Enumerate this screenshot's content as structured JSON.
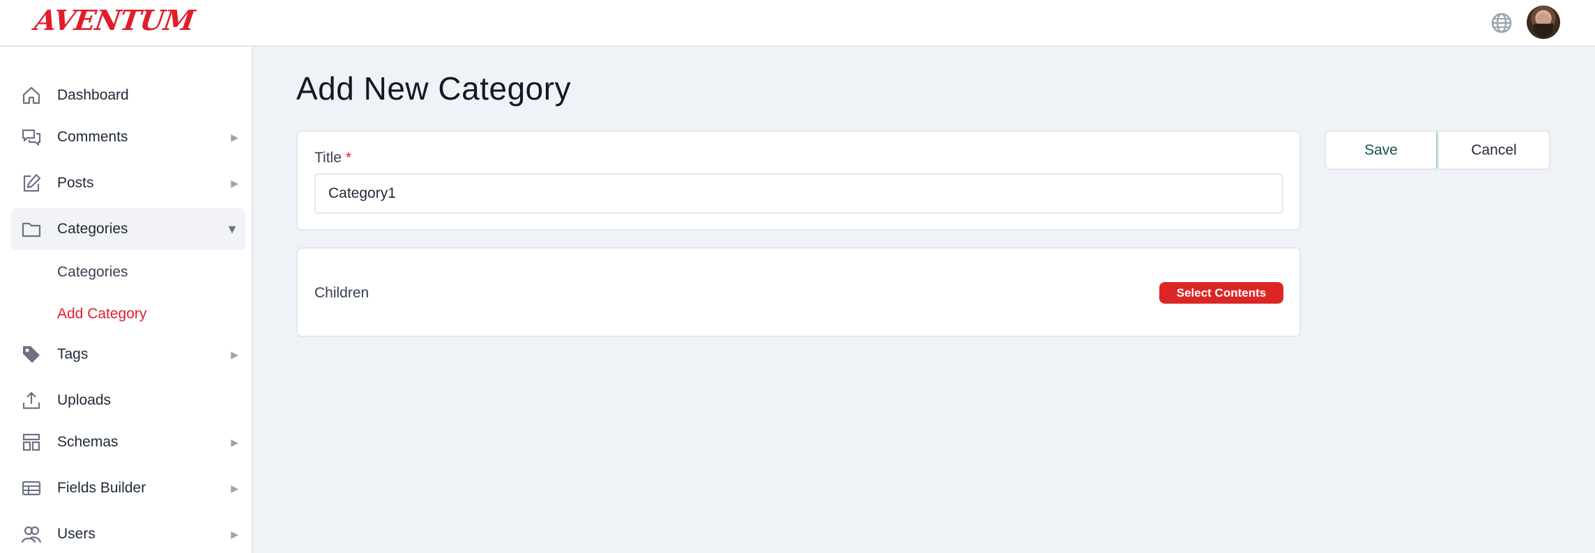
{
  "header": {
    "logo_text": "AVENTUM",
    "globe_icon": "globe-icon",
    "avatar_icon": "avatar"
  },
  "sidebar": {
    "items": [
      {
        "label": "Dashboard",
        "icon": "home-icon",
        "arrow": ""
      },
      {
        "label": "Comments",
        "icon": "comments-icon",
        "arrow": "▶"
      },
      {
        "label": "Posts",
        "icon": "edit-icon",
        "arrow": "▶"
      },
      {
        "label": "Categories",
        "icon": "folder-icon",
        "arrow": "▼"
      },
      {
        "label": "Tags",
        "icon": "tag-icon",
        "arrow": "▶"
      },
      {
        "label": "Uploads",
        "icon": "upload-icon",
        "arrow": ""
      },
      {
        "label": "Schemas",
        "icon": "layout-icon",
        "arrow": "▶"
      },
      {
        "label": "Fields Builder",
        "icon": "table-icon",
        "arrow": "▶"
      },
      {
        "label": "Users",
        "icon": "users-icon",
        "arrow": "▶"
      }
    ],
    "sub_items": [
      {
        "label": "Categories"
      },
      {
        "label": "Add Category"
      }
    ]
  },
  "main": {
    "page_title": "Add New Category",
    "title_field": {
      "label": "Title",
      "required_mark": "*",
      "value": "Category1"
    },
    "children": {
      "label": "Children",
      "button_label": "Select Contents"
    },
    "actions": {
      "save_label": "Save",
      "cancel_label": "Cancel"
    }
  },
  "colors": {
    "accent": "#e11d2a",
    "background": "#eff2f6",
    "button_red": "#dc2626",
    "save_border": "#9fdcc9"
  }
}
